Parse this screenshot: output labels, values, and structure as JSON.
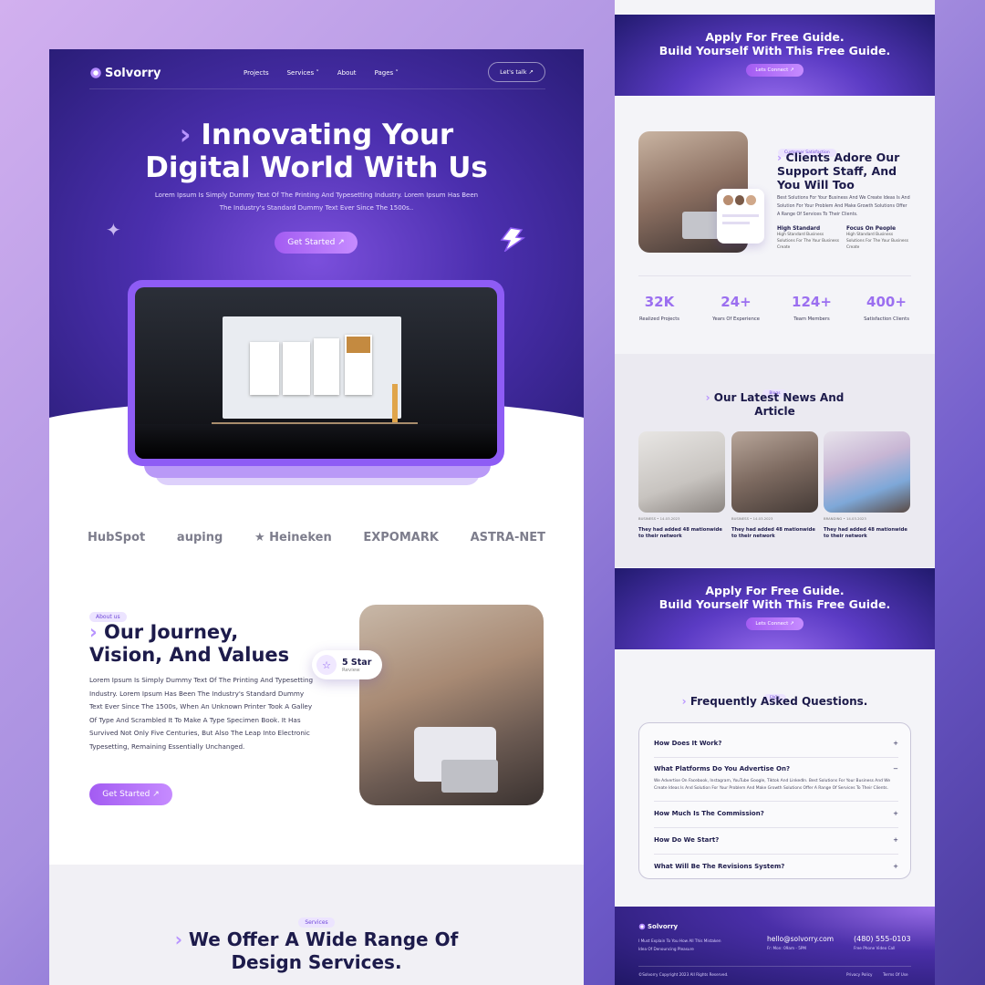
{
  "nav": {
    "brand": "Solvorry",
    "links": [
      "Projects",
      "Services ˅",
      "About",
      "Pages ˅"
    ],
    "cta": "Let's talk ↗"
  },
  "hero": {
    "title_line1": "Innovating Your",
    "title_line2": "Digital World With Us",
    "subtitle": "Lorem Ipsum Is Simply Dummy Text Of The Printing And Typesetting Industry. Lorem Ipsum Has Been The Industry's Standard Dummy Text Ever Since The 1500s..",
    "button": "Get Started ↗"
  },
  "partners": [
    "HubSpot",
    "auping",
    "★ Heineken",
    "EXPOMARK",
    "ASTRA-NET"
  ],
  "about": {
    "tag": "About us",
    "title_line1": "Our Journey,",
    "title_line2": "Vision, And Values",
    "text": "Lorem Ipsum Is Simply Dummy Text Of The Printing And Typesetting Industry. Lorem Ipsum Has Been The Industry's Standard Dummy Text Ever Since The 1500s, When An Unknown Printer Took A Galley Of Type And Scrambled It To Make A Type Specimen Book. It Has Survived Not Only Five Centuries, But Also The Leap Into Electronic Typesetting, Remaining Essentially Unchanged.",
    "button": "Get Started ↗",
    "rating_title": "5 Star",
    "rating_sub": "Review"
  },
  "services": {
    "tag": "Services",
    "title_line1": "We Offer A Wide Range Of",
    "title_line2": "Design Services."
  },
  "guide": {
    "line1": "Apply For Free Guide.",
    "line2": "Build Yourself With This Free Guide.",
    "button": "Lets Connect ↗"
  },
  "support": {
    "tag": "Customer Satisfaction",
    "title_line1": "Clients Adore Our",
    "title_line2": "Support Staff, And",
    "title_line3": "You Will Too",
    "text": "Best Solutions For Your Business And We Create Ideas Is And Solution For Your Problem And Make Growth Solutions Offer A Range Of Services To Their Clients.",
    "col1_title": "High Standard",
    "col1_text": "High Standard Business Solutions For The Your Business Create",
    "col2_title": "Focus On People",
    "col2_text": "High Standard Business Solutions For The Your Business Create"
  },
  "stats": [
    {
      "value": "32K",
      "label": "Realized Projects"
    },
    {
      "value": "24+",
      "label": "Years Of Experience"
    },
    {
      "value": "124+",
      "label": "Team Members"
    },
    {
      "value": "400+",
      "label": "Satisfaction Clients"
    }
  ],
  "news": {
    "tag": "Blogs",
    "title_line1": "Our Latest News And",
    "title_line2": "Article",
    "items": [
      {
        "meta": "BUSINESS  •  14.03.2023",
        "title": "They had added 48 mationwide to their network"
      },
      {
        "meta": "BUSINESS  •  14.03.2023",
        "title": "They had added 48 mationwide to their network"
      },
      {
        "meta": "BRANDING  •  14.03.2023",
        "title": "They had added 48 mationwide to their network"
      }
    ]
  },
  "faq": {
    "tag": "FAQs",
    "title": "Frequently Asked Questions.",
    "items": [
      {
        "q": "How Does It Work?",
        "icon": "+"
      },
      {
        "q": "What Platforms Do You Advertise On?",
        "icon": "−",
        "a": "We Advertise On Facebook, Instagram, YouTube Google, Tiktok And LinkedIn. Best Solutions For Your Business And We Create Ideas Is And Solution For Your Problem And Make Growth Solutions Offer A Range Of Services To Their Clients."
      },
      {
        "q": "How Much Is The Commission?",
        "icon": "+"
      },
      {
        "q": "How Do We Start?",
        "icon": "+"
      },
      {
        "q": "What Will Be The Revisions System?",
        "icon": "+"
      }
    ]
  },
  "footer": {
    "brand": "Solvorry",
    "desc": "I Must Explain To You How All This Mistaken Idea Of Denouncing Pleasure",
    "email": "hello@solvorry.com",
    "hours": "Fr: Mon: 09am - 5PM",
    "phone": "(480) 555-0103",
    "phone_sub": "Free Phone Video Call",
    "copyright": "©Solvorry Copyright 2023 All Rights Reserved.",
    "privacy": "Privacy Policy",
    "terms": "Terms Of Use"
  },
  "colors": {
    "accent": "#9b6ff0",
    "dark": "#1d1b4b",
    "hero": "#4b2fae"
  }
}
